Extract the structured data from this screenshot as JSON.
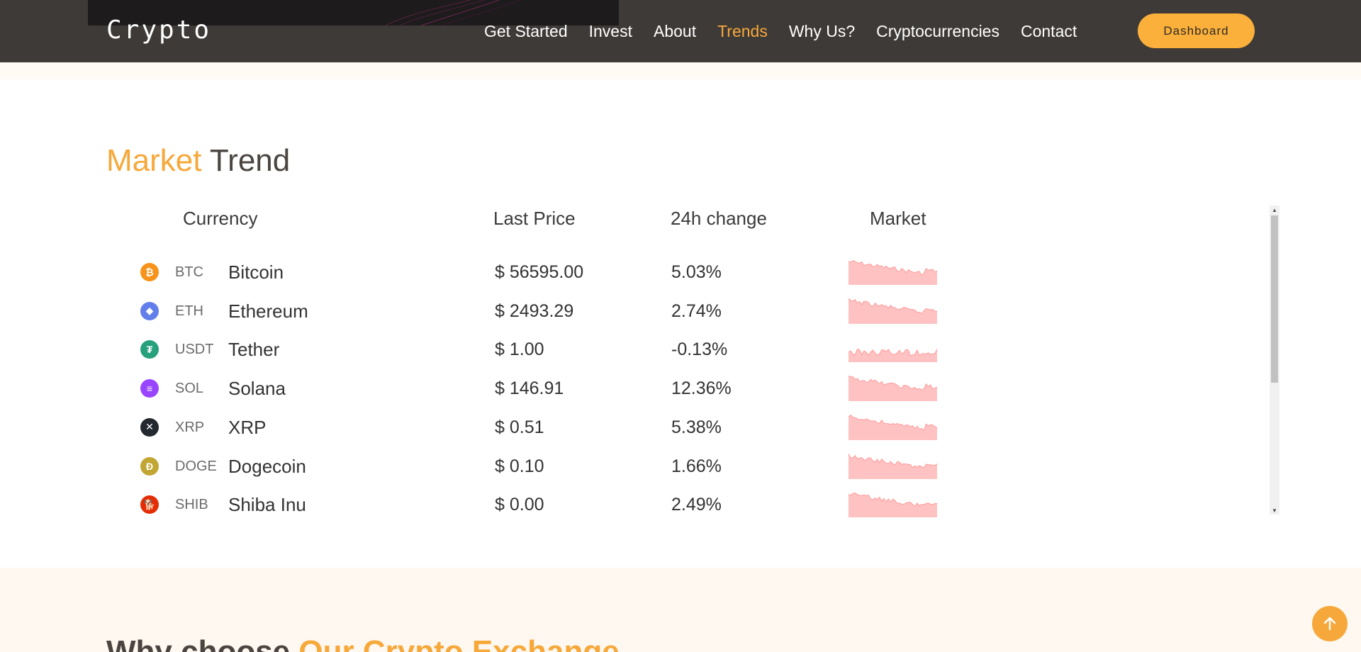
{
  "header": {
    "brand": "Crypto",
    "nav": [
      {
        "label": "Get Started",
        "active": false
      },
      {
        "label": "Invest",
        "active": false
      },
      {
        "label": "About",
        "active": false
      },
      {
        "label": "Trends",
        "active": true
      },
      {
        "label": "Why Us?",
        "active": false
      },
      {
        "label": "Cryptocurrencies",
        "active": false
      },
      {
        "label": "Contact",
        "active": false
      }
    ],
    "dashboard_label": "Dashboard"
  },
  "market": {
    "title_accent": "Market",
    "title_rest": "Trend",
    "columns": [
      "Currency",
      "Last Price",
      "24h change",
      "Market"
    ],
    "rows": [
      {
        "icon": "bitcoin-icon",
        "symbol": "BTC",
        "name": "Bitcoin",
        "price": "$ 56595.00",
        "change": "5.03%",
        "icon_color": "#f7931a",
        "glyph": "₿"
      },
      {
        "icon": "ethereum-icon",
        "symbol": "ETH",
        "name": "Ethereum",
        "price": "$ 2493.29",
        "change": "2.74%",
        "icon_color": "#627eea",
        "glyph": "◆"
      },
      {
        "icon": "tether-icon",
        "symbol": "USDT",
        "name": "Tether",
        "price": "$ 1.00",
        "change": "-0.13%",
        "icon_color": "#26a17b",
        "glyph": "₮"
      },
      {
        "icon": "solana-icon",
        "symbol": "SOL",
        "name": "Solana",
        "price": "$ 146.91",
        "change": "12.36%",
        "icon_color": "#9945ff",
        "glyph": "≡"
      },
      {
        "icon": "xrp-icon",
        "symbol": "XRP",
        "name": "XRP",
        "price": "$ 0.51",
        "change": "5.38%",
        "icon_color": "#23292f",
        "glyph": "✕"
      },
      {
        "icon": "dogecoin-icon",
        "symbol": "DOGE",
        "name": "Dogecoin",
        "price": "$ 0.10",
        "change": "1.66%",
        "icon_color": "#c2a633",
        "glyph": "Ð"
      },
      {
        "icon": "shiba-inu-icon",
        "symbol": "SHIB",
        "name": "Shiba Inu",
        "price": "$ 0.00",
        "change": "2.49%",
        "icon_color": "#e42d04",
        "glyph": "🐕"
      }
    ],
    "sparkline_color": "#ff9a9a"
  },
  "why": {
    "title_dark": "Why choose ",
    "title_accent": "Our Crypto Exchange"
  },
  "colors": {
    "accent": "#f7a83a",
    "header_bg": "#3e3a37"
  }
}
